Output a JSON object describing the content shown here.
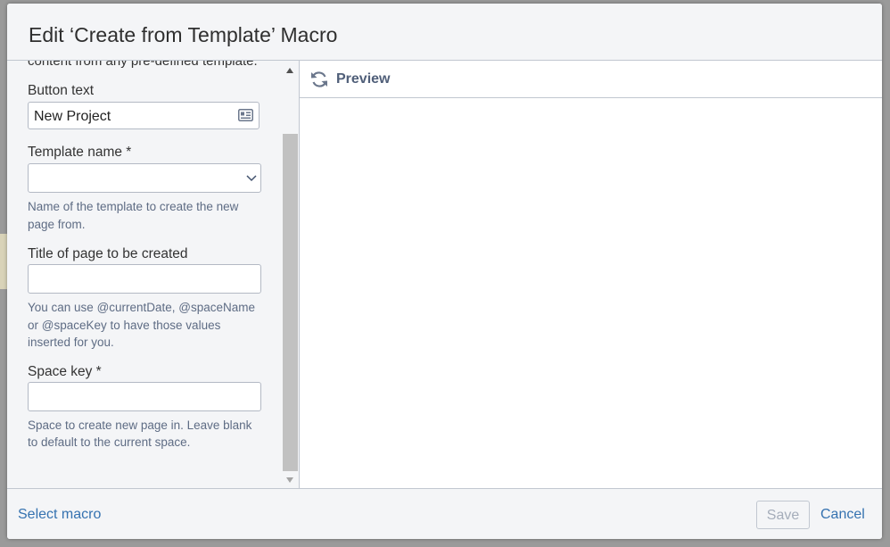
{
  "dialog": {
    "title": "Edit ‘Create from Template’ Macro"
  },
  "form": {
    "description_partial": "content from any pre-defined template.",
    "button_text": {
      "label": "Button text",
      "value": "New Project",
      "icon": "contact-card-icon"
    },
    "template_name": {
      "label": "Template name *",
      "selected": "",
      "help": "Name of the template to create the new page from.",
      "icon": "chevron-down-icon"
    },
    "page_title": {
      "label": "Title of page to be created",
      "value": "",
      "help": "You can use @currentDate, @spaceName or @spaceKey to have those values inserted for you."
    },
    "space_key": {
      "label": "Space key *",
      "value": "",
      "help": "Space to create new page in. Leave blank to default to the current space."
    }
  },
  "preview": {
    "label": "Preview",
    "icon": "refresh-icon"
  },
  "footer": {
    "select_macro": "Select macro",
    "save": "Save",
    "cancel": "Cancel"
  },
  "colors": {
    "link": "#3572b0",
    "disabled_text": "#a5adba",
    "scroll_thumb": "#c1c1c1"
  }
}
